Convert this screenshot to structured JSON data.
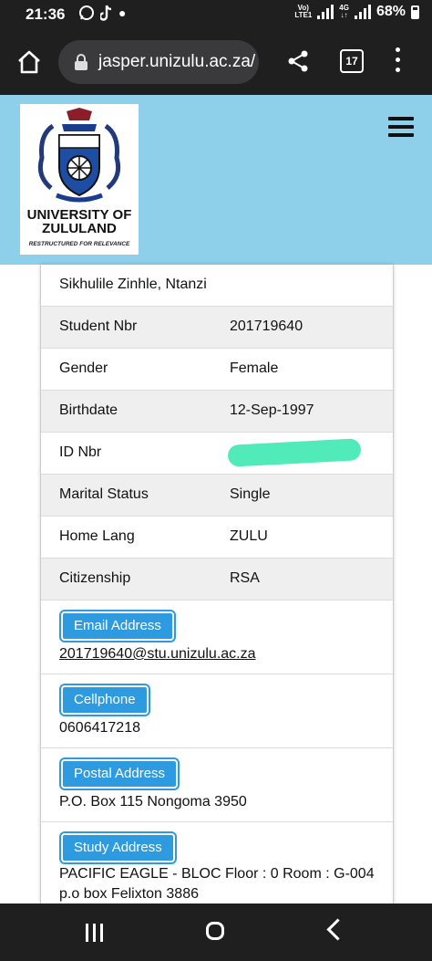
{
  "status_bar": {
    "time": "21:36",
    "network_top": "Vo)",
    "network_bottom": "LTE1",
    "net_type": "4G",
    "battery": "68%"
  },
  "browser": {
    "url": "jasper.unizulu.ac.za/",
    "tab_count": "17"
  },
  "header": {
    "logo_line1": "UNIVERSITY OF",
    "logo_line2": "ZULULAND",
    "logo_tagline": "RESTRUCTURED FOR RELEVANCE",
    "brand_color": "#8ecfea"
  },
  "profile": {
    "name": "Sikhulile Zinhle, Ntanzi",
    "rows": [
      {
        "label": "Student Nbr",
        "value": "201719640"
      },
      {
        "label": "Gender",
        "value": "Female"
      },
      {
        "label": "Birthdate",
        "value": "12-Sep-1997"
      },
      {
        "label": "ID Nbr",
        "value": ""
      },
      {
        "label": "Marital Status",
        "value": "Single"
      },
      {
        "label": "Home Lang",
        "value": "ZULU"
      },
      {
        "label": "Citizenship",
        "value": "RSA"
      }
    ],
    "email_label": "Email Address",
    "email_value": "201719640@stu.unizulu.ac.za",
    "cellphone_label": "Cellphone",
    "cellphone_value": "0606417218",
    "postal_label": "Postal Address",
    "postal_value": "P.O. Box 115 Nongoma 3950",
    "study_label": "Study Address",
    "study_value": "PACIFIC EAGLE - BLOC Floor : 0 Room : G-004 p.o box Felixton 3886"
  },
  "icons": {
    "home": "home-icon",
    "lock": "lock-icon",
    "share": "share-icon",
    "tabs": "tabs-icon",
    "menu": "more-vert-icon",
    "hamburger": "hamburger-icon"
  }
}
